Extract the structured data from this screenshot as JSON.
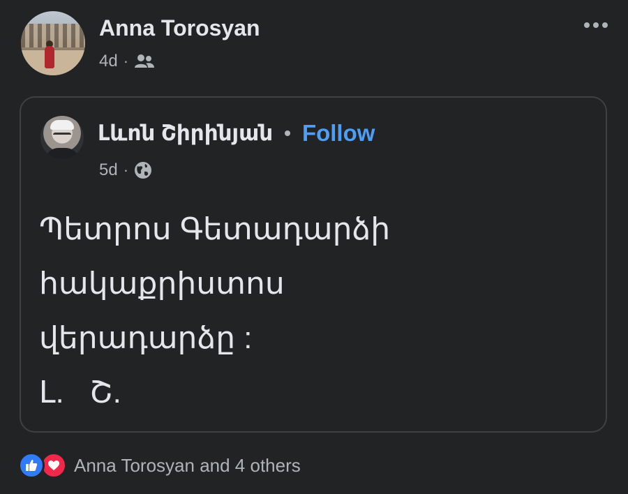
{
  "post": {
    "author": "Anna Torosyan",
    "time": "4d",
    "separator": "·",
    "audience_icon": "friends-icon",
    "more_icon": "more-options-icon"
  },
  "shared_post": {
    "author": "Լևոն Շիրինյան",
    "separator": "•",
    "follow_label": "Follow",
    "time": "5d",
    "time_separator": "·",
    "audience_icon": "globe-icon",
    "lines": [
      "Պետրոս Գետադարձի",
      "հակաքրիստոս",
      "վերադարձը :",
      "Լ.   Շ."
    ]
  },
  "reactions": {
    "icons": [
      "like-icon",
      "love-icon"
    ],
    "summary": "Anna Torosyan and 4 others"
  },
  "colors": {
    "background": "#222325",
    "card_border": "#3e4042",
    "text_primary": "#e4e6eb",
    "text_secondary": "#b0b3b8",
    "link": "#4c9ef7",
    "like": "#2f7cf6",
    "love": "#f0284a"
  }
}
